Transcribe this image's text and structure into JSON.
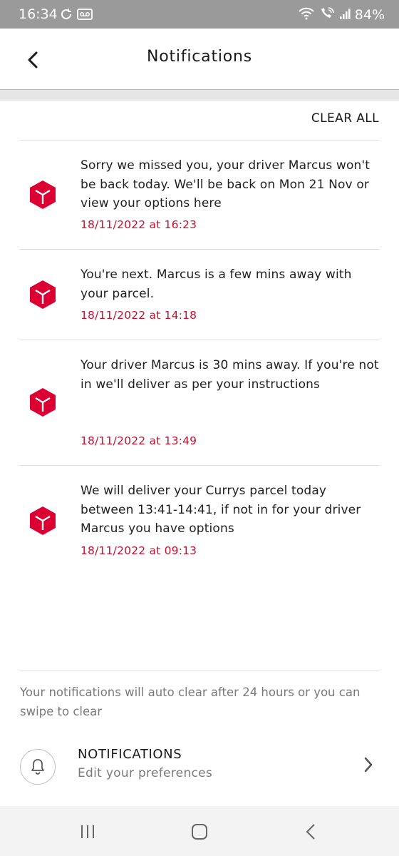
{
  "status_bar": {
    "time": "16:34",
    "battery": "84%",
    "icons": [
      "sync-icon",
      "voicemail-icon",
      "wifi-icon",
      "wifi-calling-icon",
      "signal-icon"
    ]
  },
  "header": {
    "title": "Notifications",
    "back_icon": "chevron-left-icon"
  },
  "actions": {
    "clear_all": "CLEAR ALL"
  },
  "notifications": [
    {
      "text": "Sorry we missed you, your driver Marcus won't be back today. We'll be back on Mon 21 Nov or view your options here",
      "timestamp": "18/11/2022 at 16:23",
      "icon": "parcel-box-icon"
    },
    {
      "text": "You're next. Marcus is a few mins away with your parcel.",
      "timestamp": "18/11/2022 at 14:18",
      "icon": "parcel-box-icon"
    },
    {
      "text": "Your driver Marcus is 30 mins away. If you're not in we'll deliver as per your instructions",
      "timestamp": "18/11/2022 at 13:49",
      "icon": "parcel-box-icon"
    },
    {
      "text": "We will deliver your Currys parcel today between 13:41-14:41, if not in for your driver Marcus you have options",
      "timestamp": "18/11/2022 at 09:13",
      "icon": "parcel-box-icon"
    }
  ],
  "footer": {
    "note": "Your notifications will auto clear after 24 hours or you can swipe to clear",
    "preferences": {
      "title": "NOTIFICATIONS",
      "subtitle": "Edit your preferences",
      "icon": "bell-icon"
    }
  },
  "nav_bar": {
    "icons": [
      "recent-apps-icon",
      "home-icon",
      "back-icon"
    ]
  },
  "colors": {
    "brand_red": "#dc0032",
    "timestamp_red": "#c8102e",
    "status_bar_bg": "#9a9a9a"
  }
}
